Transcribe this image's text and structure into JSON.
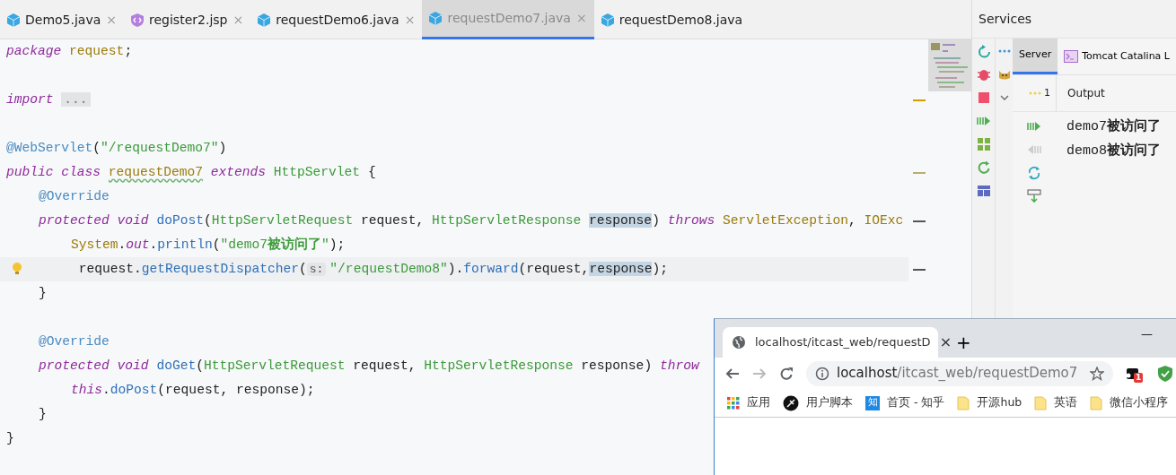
{
  "editor": {
    "tabs": [
      {
        "label": "Demo5.java",
        "kind": "java",
        "selected": false,
        "closable": true
      },
      {
        "label": "register2.jsp",
        "kind": "jsp",
        "selected": false,
        "closable": true
      },
      {
        "label": "requestDemo6.java",
        "kind": "java",
        "selected": false,
        "closable": true
      },
      {
        "label": "requestDemo7.java",
        "kind": "java",
        "selected": true,
        "closable": true
      },
      {
        "label": "requestDemo8.java",
        "kind": "java",
        "selected": false,
        "closable": false
      }
    ],
    "close_glyph": "×",
    "lines": [
      {
        "kind": "code",
        "tokens": [
          {
            "kind": "keyword",
            "text": "package"
          },
          {
            "kind": "name",
            "text": " request"
          },
          {
            "kind": "plain",
            "text": ";"
          }
        ]
      },
      {
        "kind": "blank"
      },
      {
        "kind": "code",
        "stripe": {
          "color": "#d99a00"
        },
        "tokens": [
          {
            "kind": "keyword",
            "text": "import "
          },
          {
            "kind": "fold",
            "text": "..."
          }
        ]
      },
      {
        "kind": "blank"
      },
      {
        "kind": "code",
        "tokens": [
          {
            "kind": "annotation",
            "text": "@WebServlet"
          },
          {
            "kind": "plain",
            "text": "("
          },
          {
            "kind": "string",
            "text": "\"/requestDemo7\""
          },
          {
            "kind": "plain",
            "text": ")"
          }
        ]
      },
      {
        "kind": "code",
        "stripe": {
          "color": "#b9ad6e"
        },
        "tokens": [
          {
            "kind": "keyword",
            "text": "public class "
          },
          {
            "kind": "typo",
            "text": "requestDemo7"
          },
          {
            "kind": "keyword",
            "text": " extends "
          },
          {
            "kind": "type",
            "text": "HttpServlet"
          },
          {
            "kind": "plain",
            "text": " {"
          }
        ],
        "children": [
          {
            "kind": "code",
            "tokens": [
              {
                "kind": "annotation",
                "text": "@Override"
              }
            ]
          },
          {
            "kind": "code",
            "stripe": {
              "color": "#555555"
            },
            "tokens": [
              {
                "kind": "keyword",
                "text": "protected void "
              },
              {
                "kind": "method",
                "text": "doPost"
              },
              {
                "kind": "plain",
                "text": "("
              },
              {
                "kind": "type",
                "text": "HttpServletRequest"
              },
              {
                "kind": "plain",
                "text": " request, "
              },
              {
                "kind": "type",
                "text": "HttpServletResponse "
              },
              {
                "kind": "highlight",
                "text": "response"
              },
              {
                "kind": "plain",
                "text": ") "
              },
              {
                "kind": "keyword",
                "text": "throws "
              },
              {
                "kind": "name",
                "text": "ServletException"
              },
              {
                "kind": "plain",
                "text": ", "
              },
              {
                "kind": "name",
                "text": "IOExc"
              }
            ],
            "children": [
              {
                "kind": "code",
                "tokens": [
                  {
                    "kind": "name",
                    "text": "System"
                  },
                  {
                    "kind": "plain",
                    "text": "."
                  },
                  {
                    "kind": "field",
                    "text": "out"
                  },
                  {
                    "kind": "plain",
                    "text": "."
                  },
                  {
                    "kind": "method",
                    "text": "println"
                  },
                  {
                    "kind": "plain",
                    "text": "("
                  },
                  {
                    "kind": "string",
                    "text": "\"demo7**被访问了**\""
                  },
                  {
                    "kind": "plain",
                    "text": ");"
                  }
                ]
              },
              {
                "kind": "code",
                "current": true,
                "bulb": true,
                "stripe": {
                  "color": "#555555"
                },
                "tokens": [
                  {
                    "kind": "plain",
                    "text": " request."
                  },
                  {
                    "kind": "method",
                    "text": "getRequestDispatcher"
                  },
                  {
                    "kind": "plain",
                    "text": "("
                  },
                  {
                    "kind": "hint",
                    "text": "s:"
                  },
                  {
                    "kind": "string",
                    "text": "\"/requestDemo8\""
                  },
                  {
                    "kind": "plain",
                    "text": ")."
                  },
                  {
                    "kind": "method",
                    "text": "forward"
                  },
                  {
                    "kind": "plain",
                    "text": "(request,"
                  },
                  {
                    "kind": "highlight",
                    "text": "response"
                  },
                  {
                    "kind": "plain",
                    "text": ");"
                  }
                ]
              }
            ]
          },
          {
            "kind": "code",
            "tokens": [
              {
                "kind": "plain",
                "text": "}"
              }
            ]
          },
          {
            "kind": "blank"
          },
          {
            "kind": "code",
            "tokens": [
              {
                "kind": "annotation",
                "text": "@Override"
              }
            ]
          },
          {
            "kind": "code",
            "tokens": [
              {
                "kind": "keyword",
                "text": "protected void "
              },
              {
                "kind": "method",
                "text": "doGet"
              },
              {
                "kind": "plain",
                "text": "("
              },
              {
                "kind": "type",
                "text": "HttpServletRequest"
              },
              {
                "kind": "plain",
                "text": " request, "
              },
              {
                "kind": "type",
                "text": "HttpServletResponse"
              },
              {
                "kind": "plain",
                "text": " response) "
              },
              {
                "kind": "keyword",
                "text": "throw"
              }
            ],
            "children": [
              {
                "kind": "code",
                "tokens": [
                  {
                    "kind": "keyword",
                    "text": "this"
                  },
                  {
                    "kind": "plain",
                    "text": "."
                  },
                  {
                    "kind": "method",
                    "text": "doPost"
                  },
                  {
                    "kind": "plain",
                    "text": "(request, response);"
                  }
                ]
              }
            ]
          },
          {
            "kind": "code",
            "tokens": [
              {
                "kind": "plain",
                "text": "}"
              }
            ]
          }
        ]
      },
      {
        "kind": "code",
        "tokens": [
          {
            "kind": "plain",
            "text": "}"
          }
        ]
      }
    ]
  },
  "services": {
    "title": "Services",
    "tabs": [
      {
        "label": "Server",
        "kind": "plain",
        "selected": true
      },
      {
        "label": "Tomcat Catalina L",
        "kind": "console",
        "selected": false
      }
    ],
    "output_count": "1",
    "output_label": "Output",
    "console": [
      "demo7**被访问了**",
      "demo8**被访问了**"
    ]
  },
  "browser": {
    "tab_title": "localhost/itcast_web/requestD",
    "tab_close": "×",
    "new_tab": "+",
    "minimize": "—",
    "address": {
      "host": "localhost",
      "path": "/itcast_web/requestDemo7"
    },
    "extension_badge": "1",
    "bookmarks": [
      {
        "label": "应用",
        "kind": "apps"
      },
      {
        "label": "用户脚本",
        "kind": "script"
      },
      {
        "label": "首页 - 知乎",
        "kind": "zhihu",
        "icon_text": "知"
      },
      {
        "label": "开源hub",
        "kind": "folder"
      },
      {
        "label": "英语",
        "kind": "folder"
      },
      {
        "label": "微信小程序",
        "kind": "folder"
      }
    ]
  }
}
